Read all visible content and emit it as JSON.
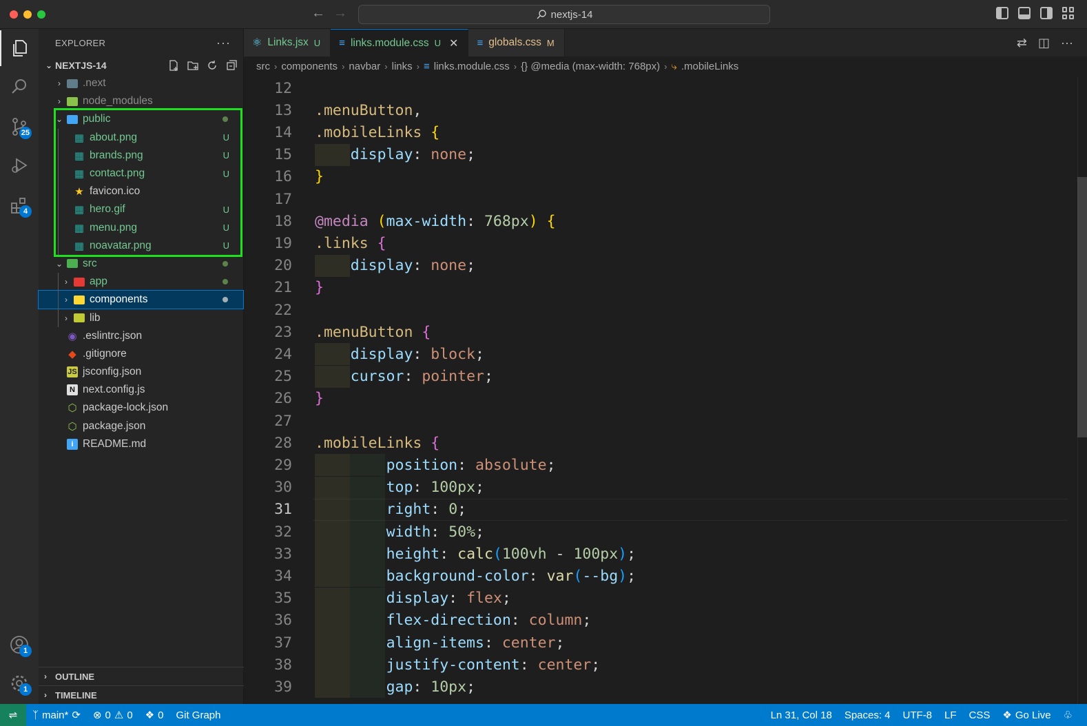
{
  "titlebar": {
    "search_text": "nextjs-14"
  },
  "activity": {
    "scm_badge": "25",
    "extensions_badge": "4",
    "accounts_badge": "1",
    "settings_badge": "1"
  },
  "explorer": {
    "title": "EXPLORER",
    "root": "NEXTJS-14",
    "items": [
      {
        "name": ".next",
        "type": "folder",
        "state": "collapsed",
        "level": 0,
        "color": "gray",
        "status": ""
      },
      {
        "name": "node_modules",
        "type": "folder",
        "state": "collapsed",
        "level": 0,
        "color": "gray",
        "status": ""
      },
      {
        "name": "public",
        "type": "folder",
        "state": "expanded",
        "level": 0,
        "color": "green",
        "status": "dot"
      },
      {
        "name": "about.png",
        "type": "image",
        "level": 1,
        "color": "green",
        "status": "U"
      },
      {
        "name": "brands.png",
        "type": "image",
        "level": 1,
        "color": "green",
        "status": "U"
      },
      {
        "name": "contact.png",
        "type": "image",
        "level": 1,
        "color": "green",
        "status": "U"
      },
      {
        "name": "favicon.ico",
        "type": "favicon",
        "level": 1,
        "color": "white",
        "status": ""
      },
      {
        "name": "hero.gif",
        "type": "image",
        "level": 1,
        "color": "green",
        "status": "U"
      },
      {
        "name": "menu.png",
        "type": "image",
        "level": 1,
        "color": "green",
        "status": "U"
      },
      {
        "name": "noavatar.png",
        "type": "image",
        "level": 1,
        "color": "green",
        "status": "U"
      },
      {
        "name": "src",
        "type": "folder",
        "state": "expanded",
        "level": 0,
        "color": "green",
        "status": "dot"
      },
      {
        "name": "app",
        "type": "folder",
        "state": "collapsed",
        "level": 1,
        "color": "green",
        "status": "dot"
      },
      {
        "name": "components",
        "type": "folder",
        "state": "collapsed",
        "level": 1,
        "color": "white",
        "status": "dot",
        "selected": true
      },
      {
        "name": "lib",
        "type": "folder",
        "state": "collapsed",
        "level": 1,
        "color": "white",
        "status": ""
      },
      {
        "name": ".eslintrc.json",
        "type": "eslint",
        "level": 0,
        "color": "white",
        "status": ""
      },
      {
        "name": ".gitignore",
        "type": "git",
        "level": 0,
        "color": "white",
        "status": ""
      },
      {
        "name": "jsconfig.json",
        "type": "jsconfig",
        "level": 0,
        "color": "white",
        "status": ""
      },
      {
        "name": "next.config.js",
        "type": "next",
        "level": 0,
        "color": "white",
        "status": ""
      },
      {
        "name": "package-lock.json",
        "type": "npm",
        "level": 0,
        "color": "white",
        "status": ""
      },
      {
        "name": "package.json",
        "type": "npm",
        "level": 0,
        "color": "white",
        "status": ""
      },
      {
        "name": "README.md",
        "type": "info",
        "level": 0,
        "color": "white",
        "status": ""
      }
    ],
    "outline": "OUTLINE",
    "timeline": "TIMELINE"
  },
  "tabs": [
    {
      "label": "Links.jsx",
      "status": "U",
      "icon": "react",
      "active": false,
      "color": "#73c991"
    },
    {
      "label": "links.module.css",
      "status": "U",
      "icon": "css",
      "active": true,
      "color": "#73c991"
    },
    {
      "label": "globals.css",
      "status": "M",
      "icon": "css",
      "active": false,
      "color": "#e2c08d"
    }
  ],
  "breadcrumb": {
    "src": "src",
    "components": "components",
    "navbar": "navbar",
    "links": "links",
    "file": "links.module.css",
    "media": "{} @media (max-width: 768px)",
    "selector": ".mobileLinks"
  },
  "editor": {
    "current_line": 31,
    "lines": [
      {
        "n": "12",
        "tokens": []
      },
      {
        "n": "13",
        "tokens": [
          [
            "sel",
            ".menuButton"
          ],
          [
            "punc",
            ","
          ]
        ]
      },
      {
        "n": "14",
        "tokens": [
          [
            "sel",
            ".mobileLinks"
          ],
          [
            "punc",
            " "
          ],
          [
            "p1",
            "{"
          ]
        ],
        "indent": 0
      },
      {
        "n": "15",
        "tokens": [
          [
            "punc",
            "    "
          ],
          [
            "prop",
            "display"
          ],
          [
            "punc",
            ": "
          ],
          [
            "val",
            "none"
          ],
          [
            "punc",
            ";"
          ]
        ],
        "indent": 1
      },
      {
        "n": "16",
        "tokens": [
          [
            "p1",
            "}"
          ]
        ]
      },
      {
        "n": "17",
        "tokens": []
      },
      {
        "n": "18",
        "tokens": [
          [
            "kw",
            "@media"
          ],
          [
            "punc",
            " "
          ],
          [
            "p1",
            "("
          ],
          [
            "prop",
            "max-width"
          ],
          [
            "punc",
            ": "
          ],
          [
            "num",
            "768px"
          ],
          [
            "p1",
            ")"
          ],
          [
            "punc",
            " "
          ],
          [
            "p1",
            "{"
          ]
        ]
      },
      {
        "n": "19",
        "tokens": [
          [
            "sel",
            ".links"
          ],
          [
            "punc",
            " "
          ],
          [
            "p2",
            "{"
          ]
        ]
      },
      {
        "n": "20",
        "tokens": [
          [
            "punc",
            "    "
          ],
          [
            "prop",
            "display"
          ],
          [
            "punc",
            ": "
          ],
          [
            "val",
            "none"
          ],
          [
            "punc",
            ";"
          ]
        ],
        "indent": 1
      },
      {
        "n": "21",
        "tokens": [
          [
            "p2",
            "}"
          ]
        ]
      },
      {
        "n": "22",
        "tokens": []
      },
      {
        "n": "23",
        "tokens": [
          [
            "sel",
            ".menuButton"
          ],
          [
            "punc",
            " "
          ],
          [
            "p2",
            "{"
          ]
        ]
      },
      {
        "n": "24",
        "tokens": [
          [
            "punc",
            "    "
          ],
          [
            "prop",
            "display"
          ],
          [
            "punc",
            ": "
          ],
          [
            "val",
            "block"
          ],
          [
            "punc",
            ";"
          ]
        ],
        "indent": 1
      },
      {
        "n": "25",
        "tokens": [
          [
            "punc",
            "    "
          ],
          [
            "prop",
            "cursor"
          ],
          [
            "punc",
            ": "
          ],
          [
            "val",
            "pointer"
          ],
          [
            "punc",
            ";"
          ]
        ],
        "indent": 1
      },
      {
        "n": "26",
        "tokens": [
          [
            "p2",
            "}"
          ]
        ]
      },
      {
        "n": "27",
        "tokens": []
      },
      {
        "n": "28",
        "tokens": [
          [
            "sel",
            ".mobileLinks"
          ],
          [
            "punc",
            " "
          ],
          [
            "p2",
            "{"
          ]
        ]
      },
      {
        "n": "29",
        "tokens": [
          [
            "punc",
            "        "
          ],
          [
            "prop",
            "position"
          ],
          [
            "punc",
            ": "
          ],
          [
            "val",
            "absolute"
          ],
          [
            "punc",
            ";"
          ]
        ],
        "indent": 2
      },
      {
        "n": "30",
        "tokens": [
          [
            "punc",
            "        "
          ],
          [
            "prop",
            "top"
          ],
          [
            "punc",
            ": "
          ],
          [
            "num",
            "100px"
          ],
          [
            "punc",
            ";"
          ]
        ],
        "indent": 2
      },
      {
        "n": "31",
        "tokens": [
          [
            "punc",
            "        "
          ],
          [
            "prop",
            "right"
          ],
          [
            "punc",
            ": "
          ],
          [
            "num",
            "0"
          ],
          [
            "punc",
            ";"
          ]
        ],
        "indent": 2
      },
      {
        "n": "32",
        "tokens": [
          [
            "punc",
            "        "
          ],
          [
            "prop",
            "width"
          ],
          [
            "punc",
            ": "
          ],
          [
            "num",
            "50%"
          ],
          [
            "punc",
            ";"
          ]
        ],
        "indent": 2
      },
      {
        "n": "33",
        "tokens": [
          [
            "punc",
            "        "
          ],
          [
            "prop",
            "height"
          ],
          [
            "punc",
            ": "
          ],
          [
            "fn",
            "calc"
          ],
          [
            "p3",
            "("
          ],
          [
            "num",
            "100vh"
          ],
          [
            "punc",
            " - "
          ],
          [
            "num",
            "100px"
          ],
          [
            "p3",
            ")"
          ],
          [
            "punc",
            ";"
          ]
        ],
        "indent": 2
      },
      {
        "n": "34",
        "tokens": [
          [
            "punc",
            "        "
          ],
          [
            "prop",
            "background-color"
          ],
          [
            "punc",
            ": "
          ],
          [
            "fn",
            "var"
          ],
          [
            "p3",
            "("
          ],
          [
            "prop",
            "--bg"
          ],
          [
            "p3",
            ")"
          ],
          [
            "punc",
            ";"
          ]
        ],
        "indent": 2
      },
      {
        "n": "35",
        "tokens": [
          [
            "punc",
            "        "
          ],
          [
            "prop",
            "display"
          ],
          [
            "punc",
            ": "
          ],
          [
            "val",
            "flex"
          ],
          [
            "punc",
            ";"
          ]
        ],
        "indent": 2
      },
      {
        "n": "36",
        "tokens": [
          [
            "punc",
            "        "
          ],
          [
            "prop",
            "flex-direction"
          ],
          [
            "punc",
            ": "
          ],
          [
            "val",
            "column"
          ],
          [
            "punc",
            ";"
          ]
        ],
        "indent": 2
      },
      {
        "n": "37",
        "tokens": [
          [
            "punc",
            "        "
          ],
          [
            "prop",
            "align-items"
          ],
          [
            "punc",
            ": "
          ],
          [
            "val",
            "center"
          ],
          [
            "punc",
            ";"
          ]
        ],
        "indent": 2
      },
      {
        "n": "38",
        "tokens": [
          [
            "punc",
            "        "
          ],
          [
            "prop",
            "justify-content"
          ],
          [
            "punc",
            ": "
          ],
          [
            "val",
            "center"
          ],
          [
            "punc",
            ";"
          ]
        ],
        "indent": 2
      },
      {
        "n": "39",
        "tokens": [
          [
            "punc",
            "        "
          ],
          [
            "prop",
            "gap"
          ],
          [
            "punc",
            ": "
          ],
          [
            "num",
            "10px"
          ],
          [
            "punc",
            ";"
          ]
        ],
        "indent": 2
      }
    ]
  },
  "statusbar": {
    "branch": "main*",
    "errors": "0",
    "warnings": "0",
    "ports": "0",
    "git_graph": "Git Graph",
    "position": "Ln 31, Col 18",
    "spaces": "Spaces: 4",
    "encoding": "UTF-8",
    "eol": "LF",
    "language": "CSS",
    "go_live": "Go Live"
  }
}
